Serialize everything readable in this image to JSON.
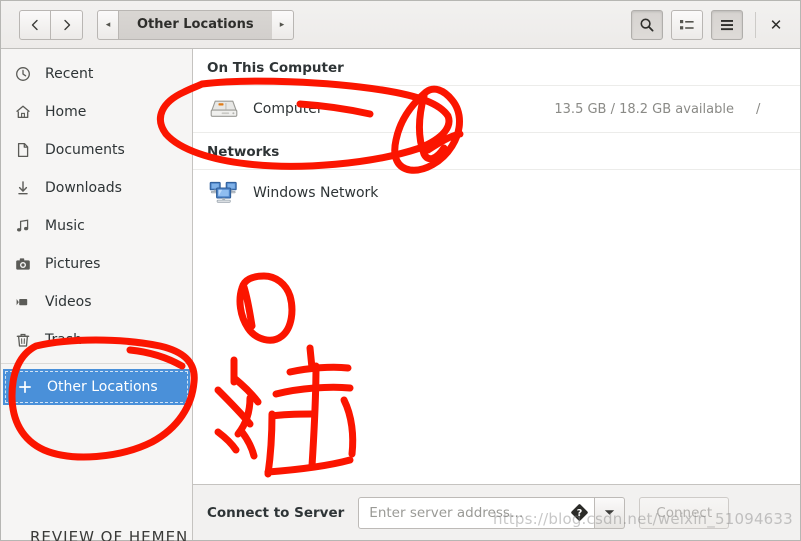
{
  "window": {
    "title": "Other Locations",
    "close_label": "✕"
  },
  "headerbar": {
    "back_label": "‹",
    "forward_label": "›",
    "path_prev_label": "◂",
    "path_current_label": "Other Locations",
    "path_next_label": "▸",
    "search_label": "search-icon",
    "view_list_label": "list-view-icon",
    "menu_label": "hamburger-menu-icon"
  },
  "sidebar": {
    "items": [
      {
        "label": "Recent",
        "icon": "clock-icon",
        "selected": false
      },
      {
        "label": "Home",
        "icon": "home-icon",
        "selected": false
      },
      {
        "label": "Documents",
        "icon": "document-icon",
        "selected": false
      },
      {
        "label": "Downloads",
        "icon": "download-icon",
        "selected": false
      },
      {
        "label": "Music",
        "icon": "music-icon",
        "selected": false
      },
      {
        "label": "Pictures",
        "icon": "camera-icon",
        "selected": false
      },
      {
        "label": "Videos",
        "icon": "video-icon",
        "selected": false
      },
      {
        "label": "Trash",
        "icon": "trash-icon",
        "selected": false
      },
      {
        "label": "Other Locations",
        "icon": "plus-icon",
        "selected": true
      }
    ]
  },
  "main": {
    "groups": [
      {
        "heading": "On This Computer",
        "rows": [
          {
            "name": "Computer",
            "icon": "hard-drive-icon",
            "free_space": "13.5 GB / 18.2 GB available",
            "mount_point": "/"
          }
        ]
      },
      {
        "heading": "Networks",
        "rows": [
          {
            "name": "Windows Network",
            "icon": "network-computers-icon",
            "free_space": "",
            "mount_point": ""
          }
        ]
      }
    ]
  },
  "footer": {
    "label": "Connect to Server",
    "address_value": "",
    "address_placeholder": "Enter server address…",
    "help_icon": "help-question-icon",
    "dropdown_icon": "chevron-down-icon",
    "connect_label": "Connect"
  },
  "overlay": {
    "watermark": "https://blog.csdn.net/weixin_51094633",
    "bottom_cropped_text": "REVIEW OF HEMEN",
    "annotation_color": "#fb1500"
  }
}
